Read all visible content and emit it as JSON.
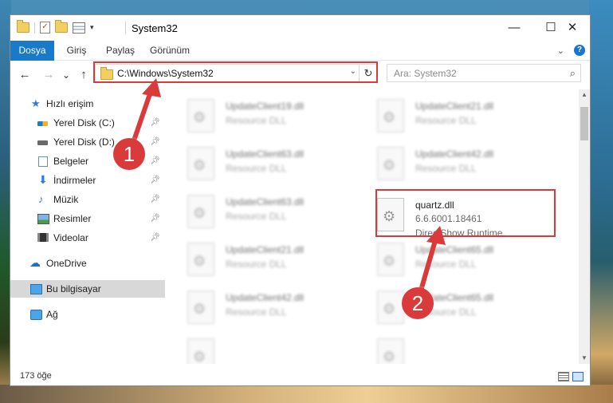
{
  "window": {
    "title": "System32",
    "controls": {
      "minimize": "—",
      "maximize": "☐",
      "close": "✕"
    }
  },
  "ribbon": {
    "tabs": [
      "Dosya",
      "Giriş",
      "Paylaş",
      "Görünüm"
    ],
    "expand_icon": "chevron-down-icon",
    "help_icon": "?"
  },
  "nav": {
    "back": "←",
    "forward": "→",
    "recent": "⌄",
    "up": "↑",
    "address_path": "C:\\Windows\\System32",
    "refresh": "↻",
    "search_placeholder": "Ara: System32"
  },
  "sidebar": {
    "items": [
      {
        "label": "Hızlı erişim",
        "icon": "star-icon",
        "pinned": false
      },
      {
        "label": "Yerel Disk (C:)",
        "icon": "drive-icon",
        "pinned": true
      },
      {
        "label": "Yerel Disk (D:)",
        "icon": "drive-icon",
        "pinned": true
      },
      {
        "label": "Belgeler",
        "icon": "documents-icon",
        "pinned": true
      },
      {
        "label": "İndirmeler",
        "icon": "downloads-icon",
        "pinned": true
      },
      {
        "label": "Müzik",
        "icon": "music-icon",
        "pinned": true
      },
      {
        "label": "Resimler",
        "icon": "pictures-icon",
        "pinned": true
      },
      {
        "label": "Videolar",
        "icon": "videos-icon",
        "pinned": true
      },
      {
        "label": "OneDrive",
        "icon": "onedrive-icon",
        "pinned": false
      },
      {
        "label": "Bu bilgisayar",
        "icon": "this-pc-icon",
        "pinned": false,
        "selected": true
      },
      {
        "label": "Ağ",
        "icon": "network-icon",
        "pinned": false
      }
    ]
  },
  "files": {
    "left": [
      {
        "name": "UpdateClient19.dll",
        "desc": "Resource DLL"
      },
      {
        "name": "UpdateClient63.dll",
        "desc": "Resource DLL"
      },
      {
        "name": "UpdateClient63.dll",
        "desc": "Resource DLL"
      },
      {
        "name": "UpdateClient21.dll",
        "desc": "Resource DLL"
      },
      {
        "name": "UpdateClient42.dll",
        "desc": "Resource DLL"
      },
      {
        "name": "",
        "desc": ""
      }
    ],
    "right": [
      {
        "name": "UpdateClient21.dll",
        "desc": "Resource DLL"
      },
      {
        "name": "UpdateClient42.dll",
        "desc": "Resource DLL"
      },
      {
        "name": "quartz.dll",
        "version": "6.6.6001.18461",
        "desc": "DirectShow Runtime.",
        "highlighted": true
      },
      {
        "name": "UpdateClient65.dll",
        "desc": "Resource DLL"
      },
      {
        "name": "UpdateClient65.dll",
        "desc": "Resource DLL"
      },
      {
        "name": "",
        "desc": ""
      }
    ]
  },
  "status": {
    "item_count": "173 öğe"
  },
  "annotations": {
    "step1": "1",
    "step2": "2",
    "color": "#d93a3a"
  }
}
